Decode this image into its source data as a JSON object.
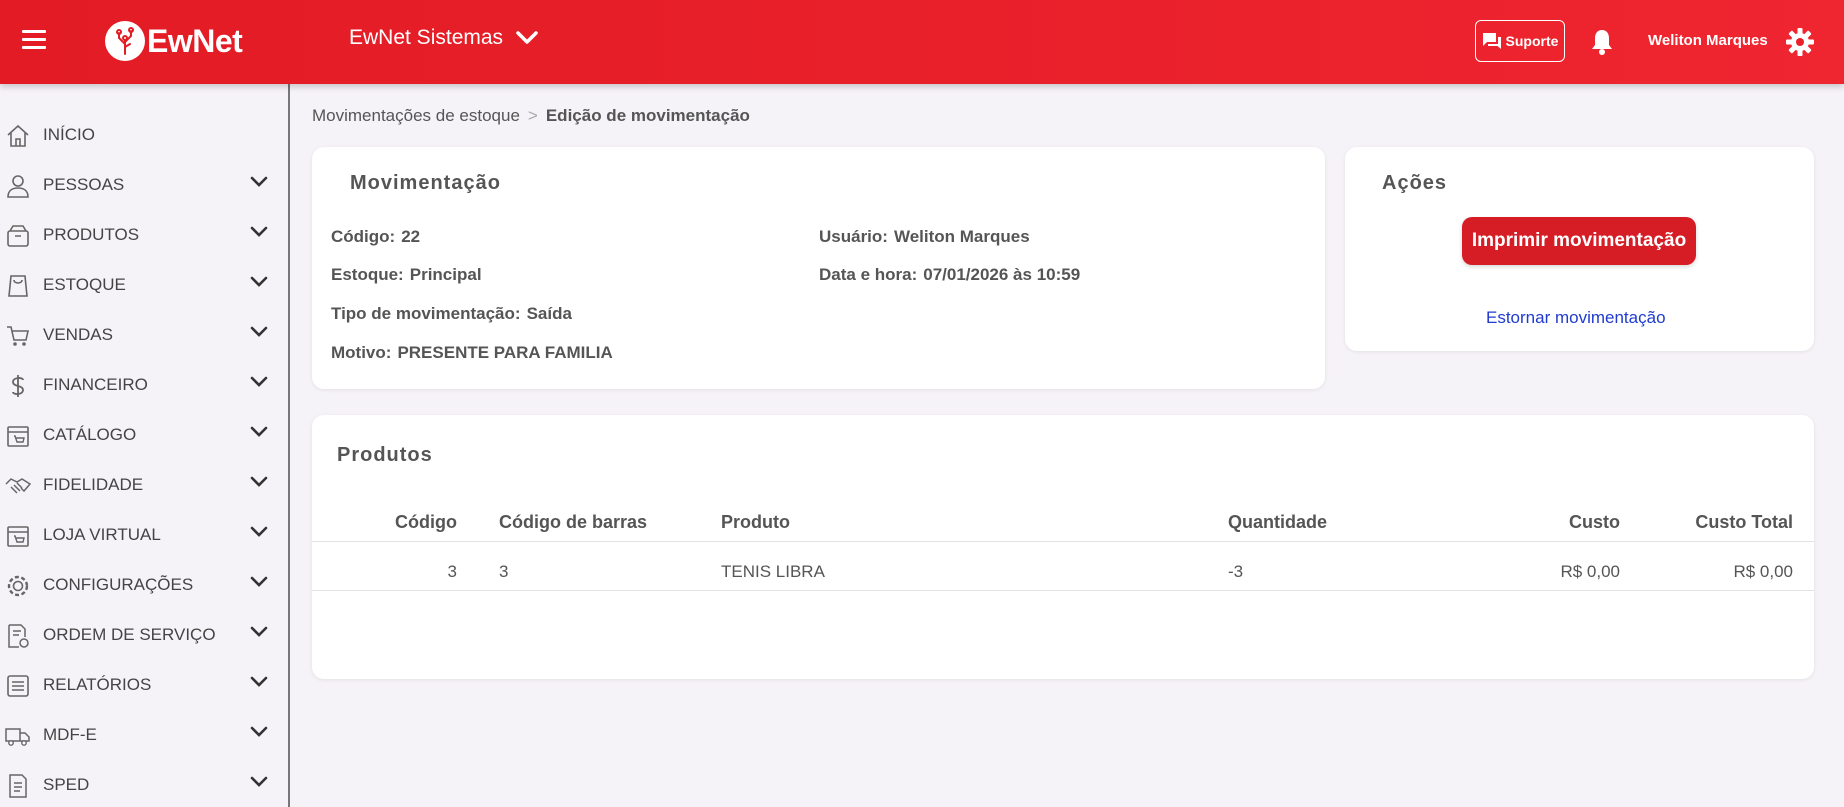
{
  "header": {
    "logo_text": "EwNet",
    "company": "EwNet Sistemas",
    "support_label": "Suporte",
    "username": "Weliton Marques"
  },
  "sidebar": {
    "items": [
      {
        "label": "INÍCIO",
        "icon": "home-icon"
      },
      {
        "label": "PESSOAS",
        "icon": "person-icon"
      },
      {
        "label": "PRODUTOS",
        "icon": "box-icon"
      },
      {
        "label": "ESTOQUE",
        "icon": "bag-icon"
      },
      {
        "label": "VENDAS",
        "icon": "cart-icon"
      },
      {
        "label": "FINANCEIRO",
        "icon": "dollar-icon"
      },
      {
        "label": "CATÁLOGO",
        "icon": "store-icon"
      },
      {
        "label": "FIDELIDADE",
        "icon": "handshake-icon"
      },
      {
        "label": "LOJA VIRTUAL",
        "icon": "store-cart-icon"
      },
      {
        "label": "CONFIGURAÇÕES",
        "icon": "gear-icon"
      },
      {
        "label": "ORDEM DE SERVIÇO",
        "icon": "document-gear-icon"
      },
      {
        "label": "RELATÓRIOS",
        "icon": "list-icon"
      },
      {
        "label": "MDF-E",
        "icon": "truck-icon"
      },
      {
        "label": "SPED",
        "icon": "file-icon"
      }
    ]
  },
  "breadcrumb": {
    "parent": "Movimentações de estoque",
    "separator": ">",
    "current": "Edição de movimentação"
  },
  "movement": {
    "title": "Movimentação",
    "codigo_label": "Código:",
    "codigo": "22",
    "estoque_label": "Estoque:",
    "estoque": "Principal",
    "tipo_label": "Tipo de movimentação:",
    "tipo": "Saída",
    "motivo_label": "Motivo:",
    "motivo": "PRESENTE PARA FAMILIA",
    "usuario_label": "Usuário:",
    "usuario": "Weliton Marques",
    "data_label": "Data e hora:",
    "data": "07/01/2026 às 10:59"
  },
  "actions": {
    "title": "Ações",
    "print_label": "Imprimir movimentação",
    "reverse_label": "Estornar movimentação"
  },
  "products": {
    "title": "Produtos",
    "columns": [
      "Código",
      "Código de barras",
      "Produto",
      "Quantidade",
      "Custo",
      "Custo Total"
    ],
    "rows": [
      [
        "3",
        "3",
        "TENIS LIBRA",
        "-3",
        "R$ 0,00",
        "R$ 0,00"
      ]
    ]
  },
  "colors": {
    "brand_red": "#e21b24",
    "button_red": "#d61d26",
    "link_blue": "#1f3bd1",
    "background": "#f6f3f8"
  }
}
